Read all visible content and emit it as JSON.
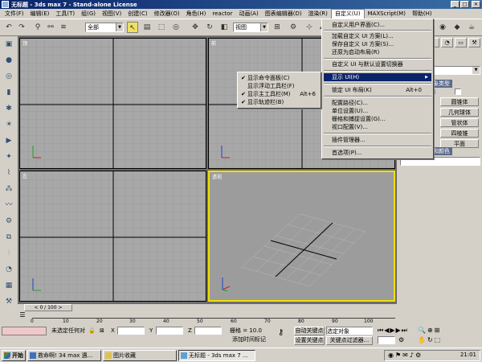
{
  "window": {
    "title": "无标题 - 3ds max 7 - Stand-alone License"
  },
  "menubar": {
    "items": [
      "文件(F)",
      "编辑(E)",
      "工具(T)",
      "组(G)",
      "视图(V)",
      "创建(C)",
      "修改器(O)",
      "角色(H)",
      "reactor",
      "动画(A)",
      "图表编辑器(D)",
      "渲染(R)",
      "自定义(U)",
      "MAXScript(M)",
      "帮助(H)"
    ]
  },
  "toolbar": {
    "selection_filter": "全部",
    "ref_coord": "视图"
  },
  "viewports": {
    "top": "顶",
    "front": "前",
    "left": "左",
    "perspective": "透视"
  },
  "customize_menu": {
    "items": [
      {
        "label": "自定义用户界面(C)..."
      },
      {
        "label": "加载自定义 UI 方案(L)..."
      },
      {
        "label": "保存自定义 UI 方案(S)..."
      },
      {
        "label": "还原为启动布局(R)"
      },
      {
        "label": "自定义 UI 与默认设置切换器"
      },
      {
        "label": "显示 UI(H)"
      },
      {
        "label": "锁定 UI 布局(K)",
        "shortcut": "Alt+0"
      },
      {
        "label": "配置路径(C)..."
      },
      {
        "label": "单位设置(U)..."
      },
      {
        "label": "栅格和捕捉设置(G)..."
      },
      {
        "label": "视口配置(V)..."
      },
      {
        "label": "插件管理器..."
      },
      {
        "label": "首选项(P)..."
      }
    ]
  },
  "show_ui_submenu": {
    "items": [
      {
        "label": "显示命令面板(C)"
      },
      {
        "label": "显示浮动工具栏(F)"
      },
      {
        "label": "显示主工具栏(M)",
        "shortcut": "Alt+6"
      },
      {
        "label": "显示轨迹栏(B)"
      }
    ]
  },
  "command_panel": {
    "section_object_type": "象类型",
    "autogrid": "格",
    "buttons": [
      "圆锥体",
      "几何球体",
      "管状体",
      "四棱锥",
      "平面"
    ],
    "section_name_color": "和颜色"
  },
  "timeline": {
    "frame_counter": "0 / 100",
    "ticks": [
      "0",
      "10",
      "20",
      "30",
      "40",
      "50",
      "60",
      "70",
      "80",
      "90",
      "100"
    ]
  },
  "status": {
    "selection": "未选定任何对",
    "x_label": "X",
    "y_label": "Y",
    "z_label": "Z",
    "grid": "栅格 = 10.0",
    "add_time_tag": "添加时间标记",
    "auto_key": "自动关键点",
    "set_key": "设置关键点",
    "selected_object": "选定对象",
    "key_filters": "关键点过滤器..."
  },
  "taskbar": {
    "start": "开始",
    "tasks": [
      "救命啊! 34 max 遇...",
      "图片收藏",
      "无标题 - 3ds max 7 ..."
    ],
    "clock": "21:01"
  }
}
